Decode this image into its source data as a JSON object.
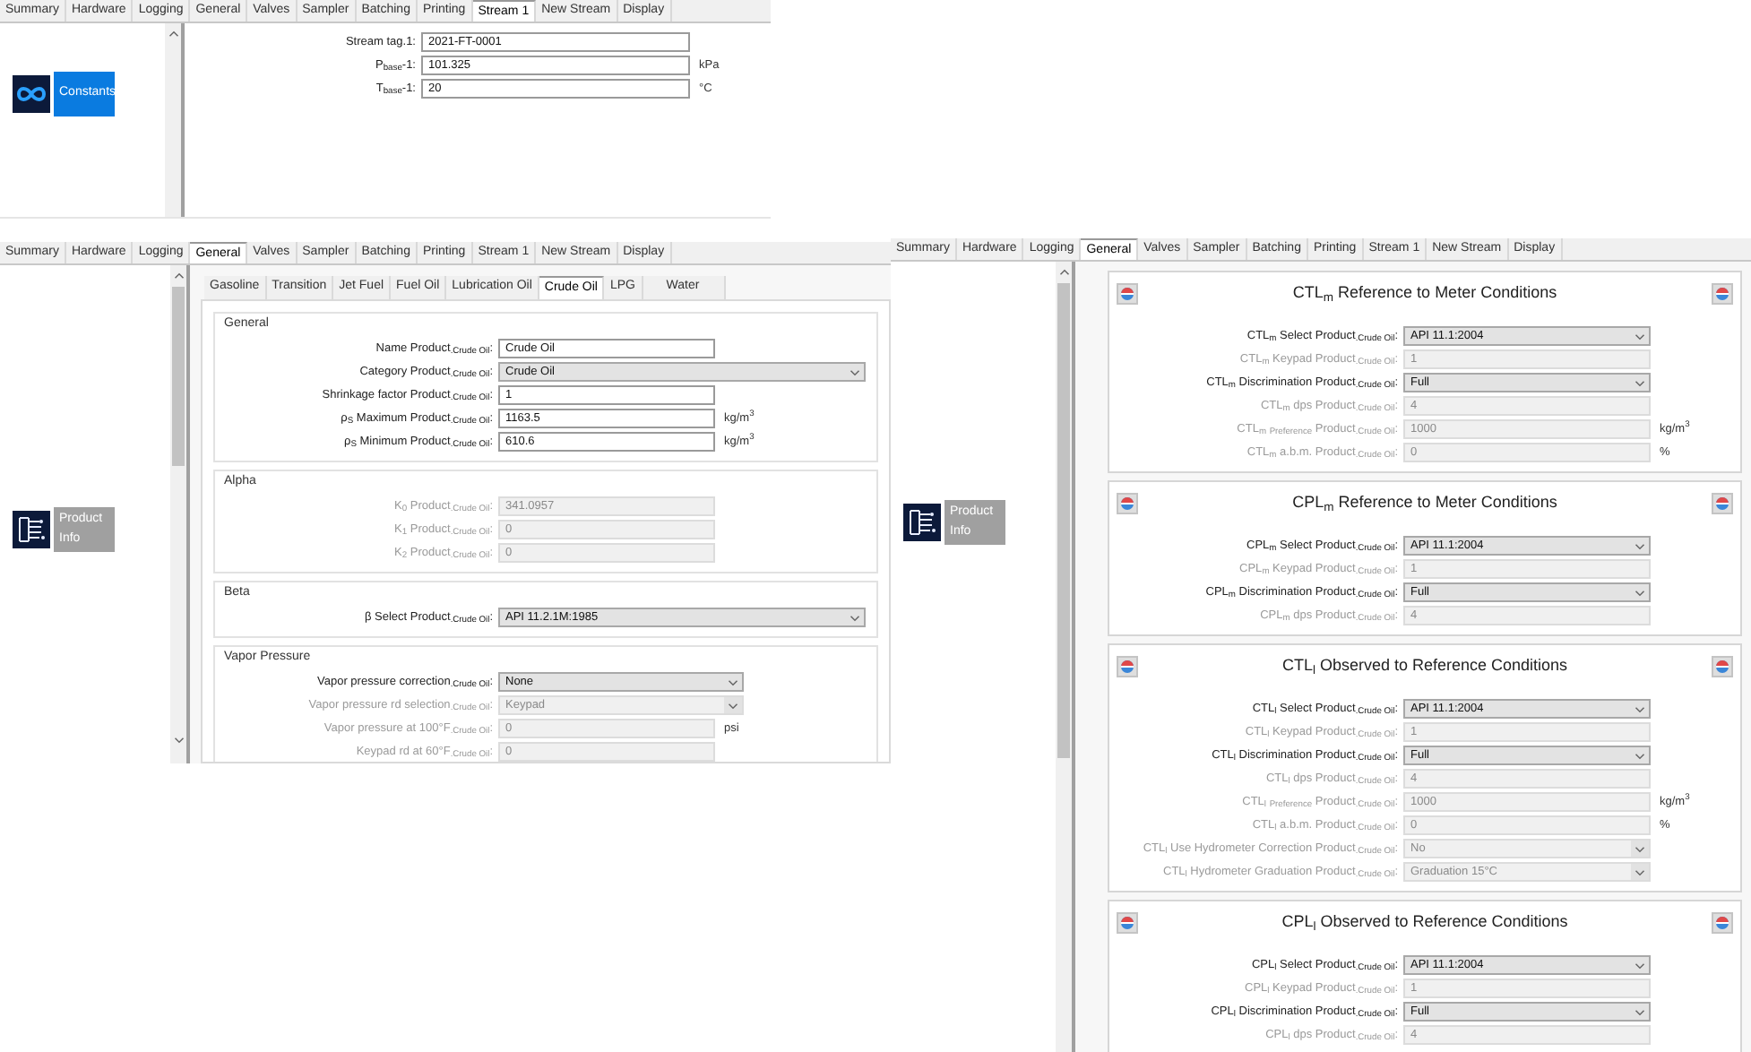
{
  "stream_window": {
    "tabs": [
      {
        "label": "Summary",
        "selected": false
      },
      {
        "label": "Hardware",
        "selected": false
      },
      {
        "label": "Logging",
        "selected": false
      },
      {
        "label": "General",
        "selected": false
      },
      {
        "label": "Valves",
        "selected": false
      },
      {
        "label": "Sampler",
        "selected": false
      },
      {
        "label": "Batching",
        "selected": false
      },
      {
        "label": "Printing",
        "selected": false
      },
      {
        "label": "Stream 1",
        "selected": true
      },
      {
        "label": "New Stream",
        "selected": false
      },
      {
        "label": "Display",
        "selected": false
      }
    ],
    "sidebar_item": {
      "kind": "infinity",
      "label": "Constants",
      "selected": true
    },
    "fields": [
      {
        "label": "Stream tag.1:",
        "kind": "text",
        "value": "2021-FT-0001",
        "disabled": false
      },
      {
        "label": "P$_{base}$-1:",
        "kind": "text",
        "value": "101.325",
        "disabled": false,
        "unit": "kPa"
      },
      {
        "label": "T$_{base}$-1:",
        "kind": "text",
        "value": "20",
        "disabled": false,
        "unit": "°C"
      }
    ]
  },
  "product_window": {
    "tabs": [
      {
        "label": "Summary",
        "selected": false
      },
      {
        "label": "Hardware",
        "selected": false
      },
      {
        "label": "Logging",
        "selected": false
      },
      {
        "label": "General",
        "selected": true
      },
      {
        "label": "Valves",
        "selected": false
      },
      {
        "label": "Sampler",
        "selected": false
      },
      {
        "label": "Batching",
        "selected": false
      },
      {
        "label": "Printing",
        "selected": false
      },
      {
        "label": "Stream 1",
        "selected": false
      },
      {
        "label": "New Stream",
        "selected": false
      },
      {
        "label": "Display",
        "selected": false
      }
    ],
    "sidebar_item": {
      "kind": "circuit",
      "label": "Product Info",
      "selected": false
    },
    "product_tabs": [
      {
        "label": "Gasoline",
        "selected": false
      },
      {
        "label": "Transition",
        "selected": false
      },
      {
        "label": "Jet Fuel",
        "selected": false
      },
      {
        "label": "Fuel Oil",
        "selected": false
      },
      {
        "label": "Lubrication Oil",
        "selected": false
      },
      {
        "label": "Crude Oil",
        "selected": true
      },
      {
        "label": "LPG",
        "selected": false
      },
      {
        "label": "Water",
        "selected": false
      }
    ],
    "groups": [
      {
        "title": "General",
        "fields": [
          {
            "label": "Name Product$_{.Crude Oil}$:",
            "kind": "text",
            "value": "Crude Oil",
            "disabled": false
          },
          {
            "label": "Category Product$_{.Crude Oil}$:",
            "kind": "select",
            "value": "Crude Oil",
            "disabled": false
          },
          {
            "label": "Shrinkage factor Product$_{.Crude Oil}$:",
            "kind": "text",
            "value": "1",
            "disabled": false
          },
          {
            "label": "ρ$_{S}$ Maximum Product$_{.Crude Oil}$:",
            "kind": "text",
            "value": "1163.5",
            "disabled": false,
            "unit": "kg/m$^{3}$"
          },
          {
            "label": "ρ$_{S}$ Minimum Product$_{.Crude Oil}$:",
            "kind": "text",
            "value": "610.6",
            "disabled": false,
            "unit": "kg/m$^{3}$"
          }
        ]
      },
      {
        "title": "Alpha",
        "fields": [
          {
            "label": "K$_{0}$ Product$_{.Crude Oil}$:",
            "kind": "text",
            "value": "341.0957",
            "disabled": true
          },
          {
            "label": "K$_{1}$ Product$_{.Crude Oil}$:",
            "kind": "text",
            "value": "0",
            "disabled": true
          },
          {
            "label": "K$_{2}$ Product$_{.Crude Oil}$:",
            "kind": "text",
            "value": "0",
            "disabled": true
          }
        ]
      },
      {
        "title": "Beta",
        "fields": [
          {
            "label": "β Select Product$_{.Crude Oil}$:",
            "kind": "select",
            "value": "API 11.2.1M:1985",
            "disabled": false
          }
        ]
      },
      {
        "title": "Vapor Pressure",
        "fields": [
          {
            "label": "Vapor pressure correction$_{.Crude Oil}$:",
            "kind": "select",
            "value": "None",
            "disabled": false
          },
          {
            "label": "Vapor pressure rd selection$_{.Crude Oil}$:",
            "kind": "select",
            "value": "Keypad",
            "disabled": true
          },
          {
            "label": "Vapor pressure at 100°F$_{.Crude Oil}$:",
            "kind": "text",
            "value": "0",
            "disabled": true,
            "unit": "psi"
          },
          {
            "label": "Keypad rd at 60°F$_{.Crude Oil}$:",
            "kind": "text",
            "value": "0",
            "disabled": true
          }
        ]
      }
    ]
  },
  "correction_window": {
    "tabs": [
      {
        "label": "Summary",
        "selected": false
      },
      {
        "label": "Hardware",
        "selected": false
      },
      {
        "label": "Logging",
        "selected": false
      },
      {
        "label": "General",
        "selected": true
      },
      {
        "label": "Valves",
        "selected": false
      },
      {
        "label": "Sampler",
        "selected": false
      },
      {
        "label": "Batching",
        "selected": false
      },
      {
        "label": "Printing",
        "selected": false
      },
      {
        "label": "Stream 1",
        "selected": false
      },
      {
        "label": "New Stream",
        "selected": false
      },
      {
        "label": "Display",
        "selected": false
      }
    ],
    "sidebar_item": {
      "kind": "circuit",
      "label": "Product Info",
      "selected": false
    },
    "sections": [
      {
        "title": "CTL$_{m}$ Reference to Meter Conditions",
        "fields": [
          {
            "label": "CTL$_{m}$ Select Product$_{.Crude Oil}$:",
            "kind": "select",
            "value": "API 11.1:2004",
            "disabled": false
          },
          {
            "label": "CTL$_{m}$ Keypad Product$_{.Crude Oil}$:",
            "kind": "text",
            "value": "1",
            "disabled": true
          },
          {
            "label": "CTL$_{m}$ Discrimination Product$_{.Crude Oil}$:",
            "kind": "select",
            "value": "Full",
            "disabled": false
          },
          {
            "label": "CTL$_{m}$ dps Product$_{.Crude Oil}$:",
            "kind": "text",
            "value": "4",
            "disabled": true
          },
          {
            "label": "CTL$_{m}$ $_{Preference}$ Product$_{.Crude Oil}$:",
            "kind": "text",
            "value": "1000",
            "disabled": true,
            "unit": "kg/m$^{3}$"
          },
          {
            "label": "CTL$_{m}$ a.b.m. Product$_{.Crude Oil}$:",
            "kind": "text",
            "value": "0",
            "disabled": true,
            "unit": "%"
          }
        ]
      },
      {
        "title": "CPL$_{m}$ Reference to Meter Conditions",
        "fields": [
          {
            "label": "CPL$_{m}$ Select Product$_{.Crude Oil}$:",
            "kind": "select",
            "value": "API 11.1:2004",
            "disabled": false
          },
          {
            "label": "CPL$_{m}$ Keypad Product$_{.Crude Oil}$:",
            "kind": "text",
            "value": "1",
            "disabled": true
          },
          {
            "label": "CPL$_{m}$ Discrimination Product$_{.Crude Oil}$:",
            "kind": "select",
            "value": "Full",
            "disabled": false
          },
          {
            "label": "CPL$_{m}$ dps Product$_{.Crude Oil}$:",
            "kind": "text",
            "value": "4",
            "disabled": true
          }
        ]
      },
      {
        "title": "CTL$_{l}$ Observed to Reference Conditions",
        "fields": [
          {
            "label": "CTL$_{l}$ Select Product$_{.Crude Oil}$:",
            "kind": "select",
            "value": "API 11.1:2004",
            "disabled": false
          },
          {
            "label": "CTL$_{l}$ Keypad Product$_{.Crude Oil}$:",
            "kind": "text",
            "value": "1",
            "disabled": true
          },
          {
            "label": "CTL$_{l}$ Discrimination Product$_{.Crude Oil}$:",
            "kind": "select",
            "value": "Full",
            "disabled": false
          },
          {
            "label": "CTL$_{l}$ dps Product$_{.Crude Oil}$:",
            "kind": "text",
            "value": "4",
            "disabled": true
          },
          {
            "label": "CTL$_{l}$ $_{Preference}$ Product$_{.Crude Oil}$:",
            "kind": "text",
            "value": "1000",
            "disabled": true,
            "unit": "kg/m$^{3}$"
          },
          {
            "label": "CTL$_{l}$ a.b.m. Product$_{.Crude Oil}$:",
            "kind": "text",
            "value": "0",
            "disabled": true,
            "unit": "%"
          },
          {
            "label": "CTL$_{l}$ Use Hydrometer Correction Product$_{.Crude Oil}$:",
            "kind": "select",
            "value": "No",
            "disabled": true
          },
          {
            "label": "CTL$_{l}$ Hydrometer Graduation Product$_{.Crude Oil}$:",
            "kind": "select",
            "value": "Graduation 15°C",
            "disabled": true
          }
        ]
      },
      {
        "title": "CPL$_{l}$ Observed to Reference Conditions",
        "fields": [
          {
            "label": "CPL$_{l}$ Select Product$_{.Crude Oil}$:",
            "kind": "select",
            "value": "API 11.1:2004",
            "disabled": false
          },
          {
            "label": "CPL$_{l}$ Keypad Product$_{.Crude Oil}$:",
            "kind": "text",
            "value": "1",
            "disabled": true
          },
          {
            "label": "CPL$_{l}$ Discrimination Product$_{.Crude Oil}$:",
            "kind": "select",
            "value": "Full",
            "disabled": false
          },
          {
            "label": "CPL$_{l}$ dps Product$_{.Crude Oil}$:",
            "kind": "text",
            "value": "4",
            "disabled": true
          }
        ]
      }
    ]
  }
}
